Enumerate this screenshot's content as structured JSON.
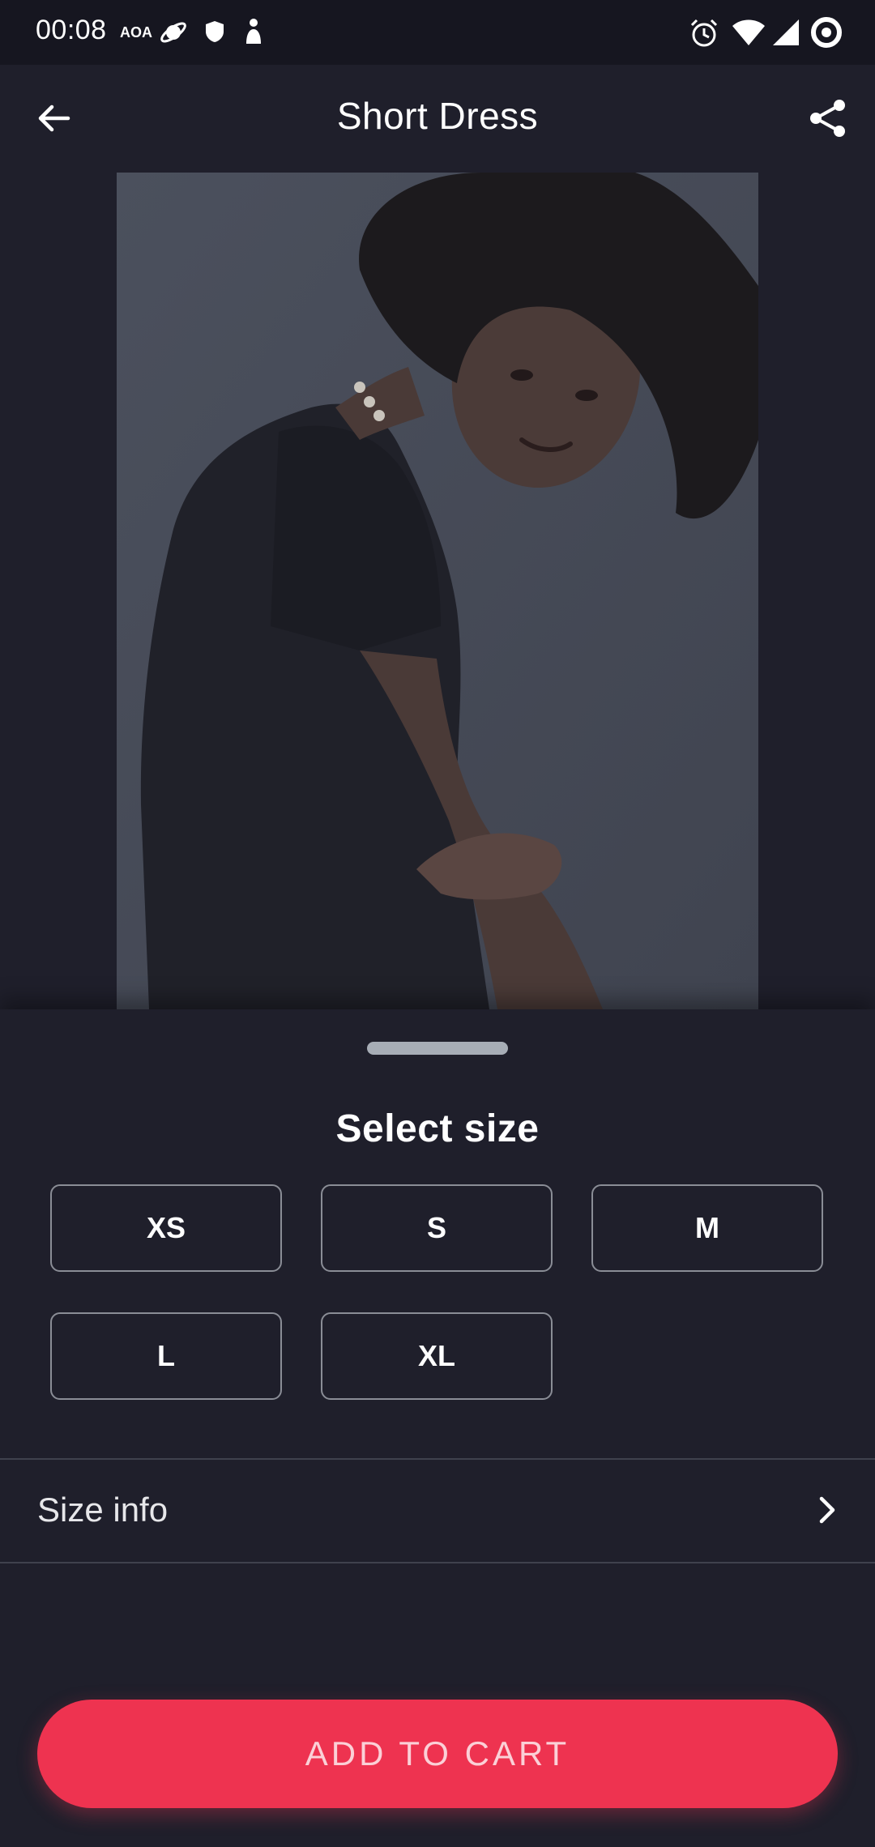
{
  "status_bar": {
    "time": "00:08",
    "carrier_tag": "AOA",
    "icons": [
      "saturn-icon",
      "shield-icon",
      "figure-icon",
      "alarm-icon",
      "wifi-icon",
      "signal-icon",
      "circle-target-icon"
    ]
  },
  "header": {
    "title": "Short Dress",
    "back_icon": "arrow-left-icon",
    "share_icon": "share-icon"
  },
  "product": {
    "image_alt": "Model wearing short black dress"
  },
  "size_sheet": {
    "title": "Select size",
    "sizes": [
      "XS",
      "S",
      "M",
      "L",
      "XL"
    ],
    "size_info_label": "Size info",
    "size_info_icon": "chevron-right-icon",
    "cta_label": "ADD TO CART"
  },
  "colors": {
    "background": "#1f1f2b",
    "status_bar": "#161620",
    "accent": "#ee3350",
    "border": "#8a8d96"
  }
}
